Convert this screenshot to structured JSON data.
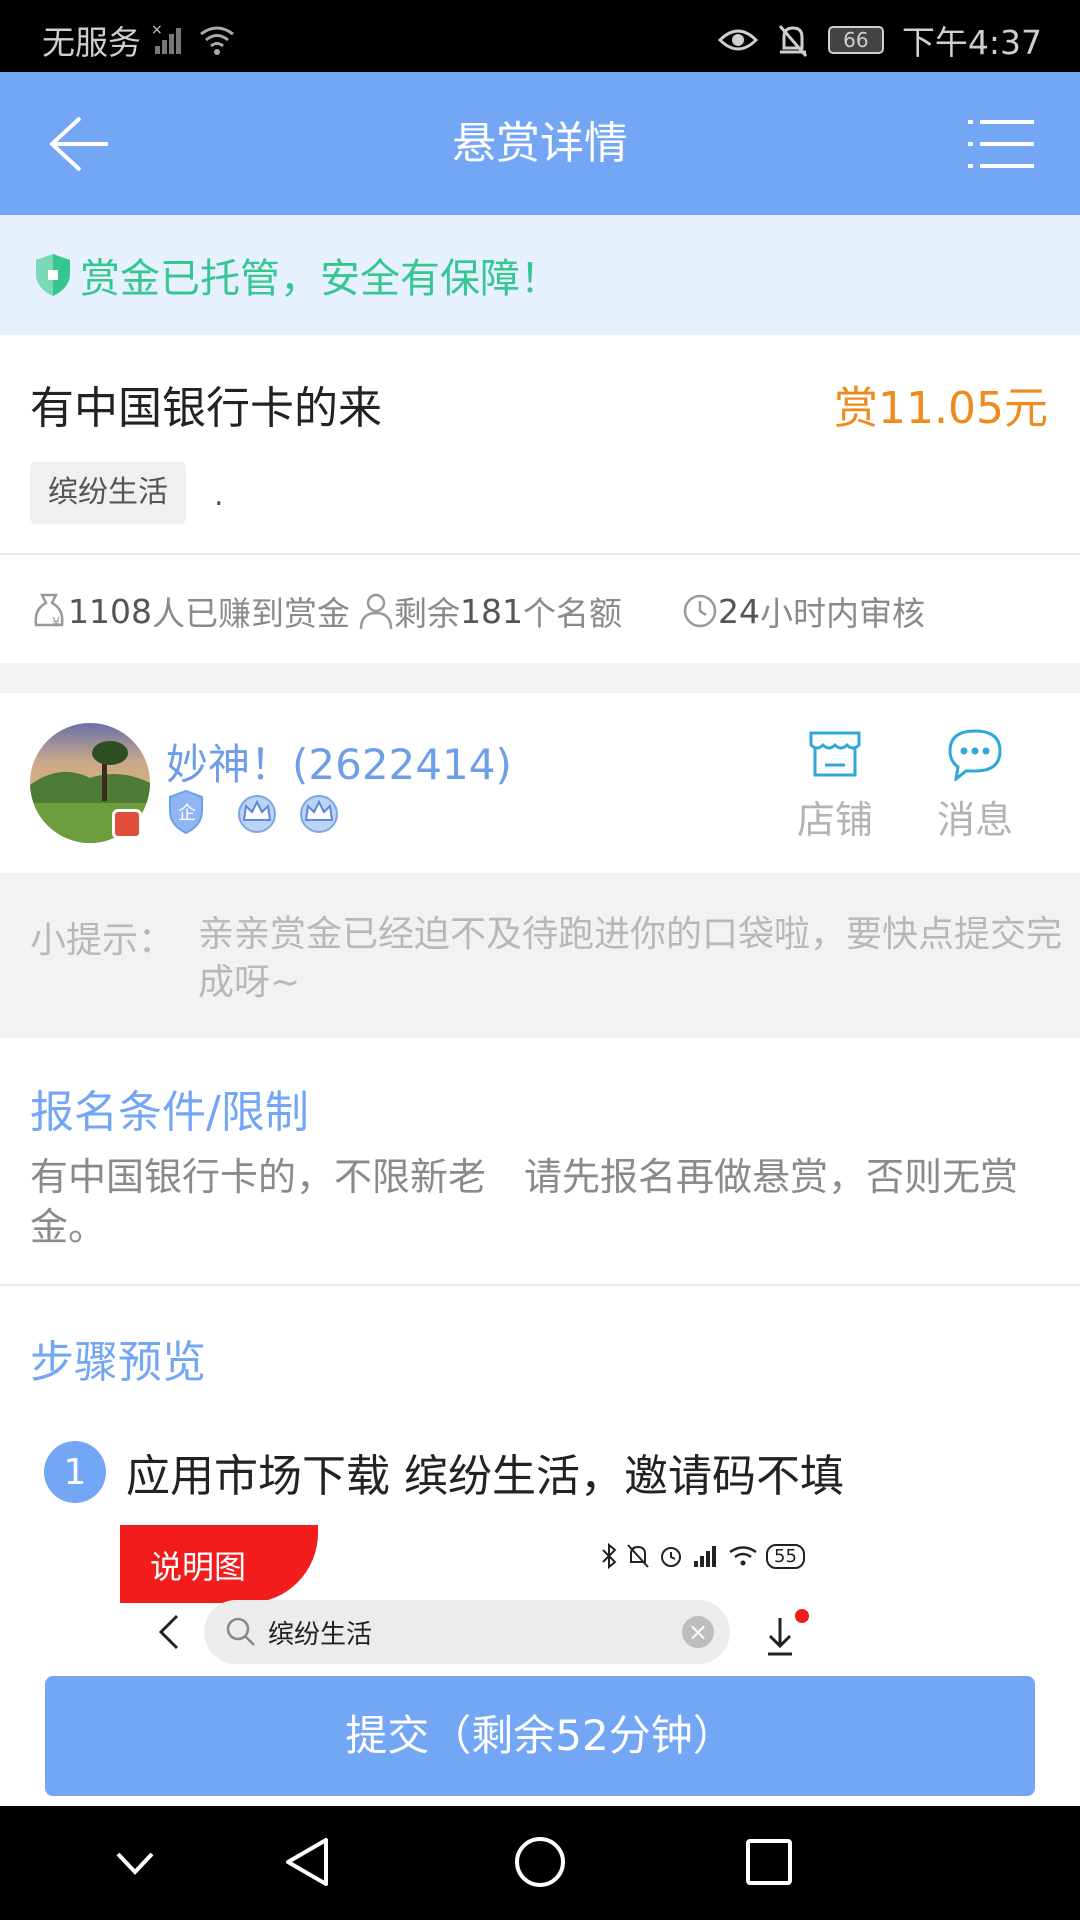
{
  "status_bar": {
    "carrier": "无服务",
    "battery": "66",
    "time": "下午4:37"
  },
  "nav": {
    "title": "悬赏详情"
  },
  "notice": {
    "text": "赏金已托管，安全有保障！"
  },
  "task": {
    "title": "有中国银行卡的来",
    "reward": "赏11.05元",
    "tag": "缤纷生活",
    "tag_suffix": "."
  },
  "stats": {
    "earned_count": "1108",
    "earned_label": "人已赚到赏金",
    "remaining_prefix": "剩余",
    "remaining_count": "181",
    "remaining_suffix": "个名额",
    "review_num": "24",
    "review_label": "小时内审核"
  },
  "publisher": {
    "name": "妙神！(2622414)",
    "shop_label": "店铺",
    "message_label": "消息"
  },
  "tip": {
    "label": "小提示：",
    "content": "亲亲赏金已经迫不及待跑进你的口袋啦，要快点提交完成呀~"
  },
  "conditions": {
    "title": "报名条件/限制",
    "text": "有中国银行卡的，不限新老　请先报名再做悬赏，否则无赏金。"
  },
  "steps": {
    "title": "步骤预览",
    "items": [
      {
        "number": "1",
        "text": "应用市场下载  缤纷生活，邀请码不填"
      }
    ],
    "screenshot": {
      "flag_label": "说明图",
      "search_text": "缤纷生活",
      "battery": "55"
    }
  },
  "submit": {
    "label": "提交（剩余52分钟）"
  },
  "colors": {
    "primary": "#74a6f6",
    "reward": "#f08a1c",
    "notice_green": "#35c78f",
    "flag_red": "#f21c1c"
  }
}
